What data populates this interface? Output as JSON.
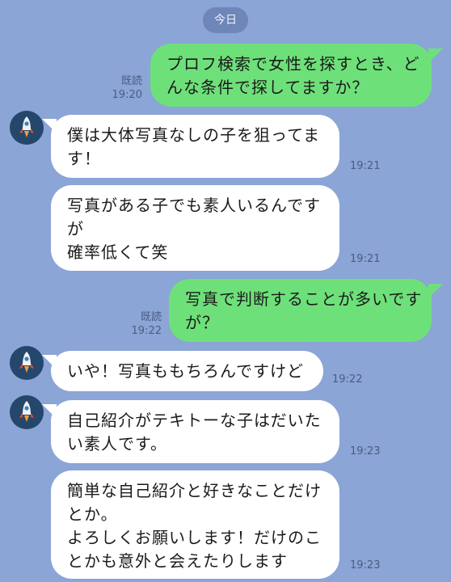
{
  "date_label": "今日",
  "messages": [
    {
      "lines": [
        "プロフ検索で女性を探すとき、ど",
        "んな条件で探してますか？"
      ],
      "read": "既読",
      "time": "19:20"
    },
    {
      "lines": [
        "僕は大体写真なしの子を狙ってま",
        "す！"
      ],
      "time": "19:21"
    },
    {
      "lines": [
        "写真がある子でも素人いるんです",
        "が",
        "確率低くて笑"
      ],
      "time": "19:21"
    },
    {
      "lines": [
        "写真で判断することが多いです",
        "が？"
      ],
      "read": "既読",
      "time": "19:22"
    },
    {
      "lines": [
        "いや！写真ももちろんですけど"
      ],
      "time": "19:22"
    },
    {
      "lines": [
        "自己紹介がテキトーな子はだいた",
        "い素人です。"
      ],
      "time": "19:23"
    },
    {
      "lines": [
        "簡単な自己紹介と好きなことだけ",
        "とか。",
        "よろしくお願いします！だけのこ",
        "とかも意外と会えたりします"
      ],
      "time": "19:23"
    }
  ],
  "colors": {
    "background": "#8aa5d6",
    "sent_bubble": "#6ee07a",
    "received_bubble": "#ffffff",
    "avatar": "#24476b"
  },
  "icons": {
    "avatar": "rocket-icon"
  }
}
